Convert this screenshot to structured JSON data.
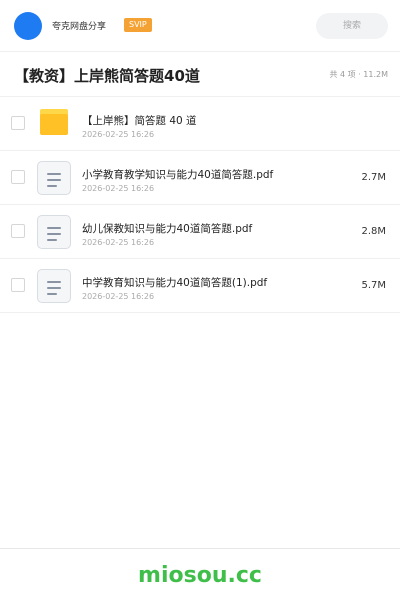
{
  "header": {
    "username": "夸克网盘分享",
    "badge": "SVIP",
    "search_label": "搜索",
    "avatar_color": "#1f7bf2",
    "badge_color": "#f5a234"
  },
  "folder_header": {
    "title": "【教资】上岸熊简答题40道",
    "summary": "共 4 项 · 11.2M"
  },
  "files": [
    {
      "name": "【上岸熊】简答题 40 道",
      "date": "2026-02-25 16:26",
      "size": "",
      "icon": "folder-icon"
    },
    {
      "name": "小学教育教学知识与能力40道简答题.pdf",
      "date": "2026-02-25 16:26",
      "size": "2.7M",
      "icon": "document-icon"
    },
    {
      "name": "幼儿保教知识与能力40道简答题.pdf",
      "date": "2026-02-25 16:26",
      "size": "2.8M",
      "icon": "document-icon"
    },
    {
      "name": "中学教育知识与能力40道简答题(1).pdf",
      "date": "2026-02-25 16:26",
      "size": "5.7M",
      "icon": "document-icon"
    }
  ],
  "footer": {
    "brand": "miosou.cc",
    "brand_color": "#3fbf4a"
  }
}
